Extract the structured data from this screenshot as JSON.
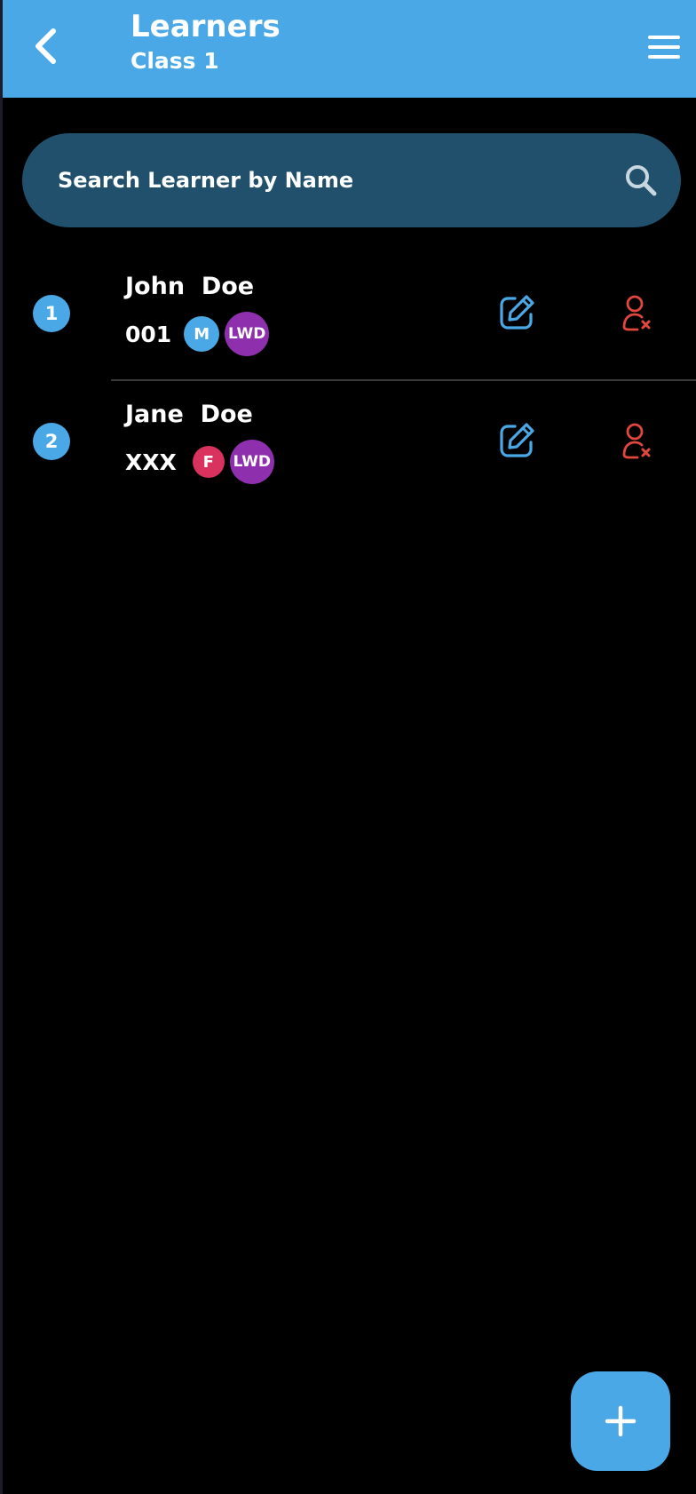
{
  "header": {
    "title": "Learners",
    "subtitle": "Class 1",
    "back_icon": "chevron-left-icon",
    "menu_icon": "hamburger-menu-icon",
    "background": "#4aa8e6"
  },
  "search": {
    "placeholder": "Search Learner by Name",
    "value": "",
    "icon": "search-icon"
  },
  "learners": [
    {
      "number": "1",
      "name": "John  Doe",
      "code": "001",
      "gender": "M",
      "gender_color": "#4aa8e6",
      "tag": "LWD",
      "edit_icon": "edit-icon",
      "remove_icon": "remove-user-icon"
    },
    {
      "number": "2",
      "name": "Jane  Doe",
      "code": "XXX",
      "gender": "F",
      "gender_color": "#d9325e",
      "tag": "LWD",
      "edit_icon": "edit-icon",
      "remove_icon": "remove-user-icon"
    }
  ],
  "fab": {
    "icon": "plus-icon",
    "color": "#4aa8e6"
  },
  "colors": {
    "accent": "#4aa8e6",
    "search_bg": "#21506d",
    "lwd": "#8e2fae",
    "remove": "#e2473d"
  }
}
